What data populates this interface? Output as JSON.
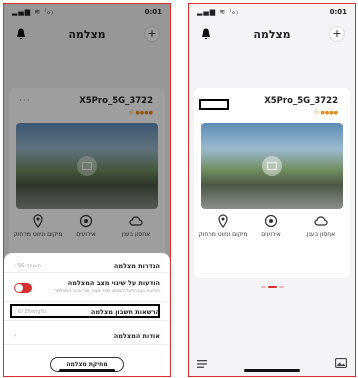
{
  "left": {
    "status": {
      "signal": "▂▄▆ ≋ ⁽ₒ₎",
      "time": "0:01"
    },
    "header": {
      "title": "מצלמה",
      "plus": "+"
    },
    "camera": {
      "model": "X5Pro_5G_3722",
      "sub": "⓪ ●●●●",
      "more": "···"
    },
    "actions": [
      "מיקום וניווט מרחוק",
      "אירועים",
      "אחסון בענן"
    ],
    "sheet": {
      "rows": [
        {
          "title": "הגדרות מצלמה",
          "value": "‹ 5G משותף"
        },
        {
          "title": "הודעות על שינוי מצב המצלמה",
          "sub": "הודעות כגון הפעלה/כיבוי, שינוי מצב, וכו' עבור המצלמה"
        },
        {
          "title": "הרשאות חשבון מצלמה",
          "value": "‹ ID ZhengYu"
        },
        {
          "title": "אודות המצלמה",
          "value": "›"
        }
      ],
      "delete_label": "מחיקת מצלמה"
    }
  },
  "right": {
    "status": {
      "signal": "▂▄▆ ≋ ⁽ₒ₎",
      "time": "0:01"
    },
    "header": {
      "title": "מצלמה",
      "plus": "+"
    },
    "camera": {
      "model": "X5Pro_5G_3722",
      "sub": "⓪ ●●●●",
      "more": "···"
    },
    "actions": [
      "מיקום וניווט מרחוק",
      "אירועים",
      "אחסון בענן"
    ]
  },
  "colors": {
    "accent": "#d8302f",
    "highlight": "#000000"
  },
  "icons": [
    "bell-icon",
    "plus-icon",
    "more-icon",
    "video-camera-icon",
    "location-pin-icon",
    "events-icon",
    "cloud-icon",
    "menu-icon",
    "gallery-icon"
  ]
}
